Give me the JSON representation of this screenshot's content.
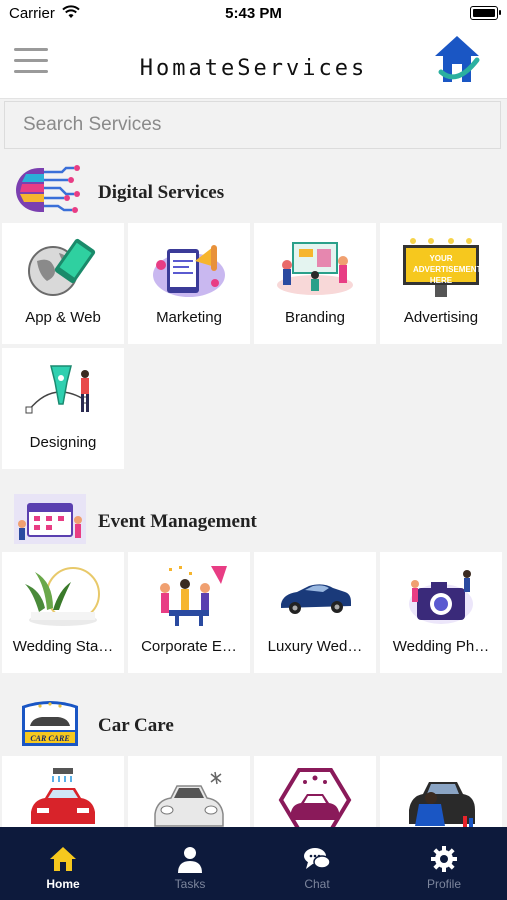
{
  "status_bar": {
    "carrier": "Carrier",
    "time": "5:43 PM"
  },
  "header": {
    "title": "HomateServices"
  },
  "search": {
    "placeholder": "Search Services"
  },
  "sections": [
    {
      "title": "Digital Services",
      "icon": "digital-services-icon",
      "items": [
        {
          "label": "App & Web",
          "icon": "app-web-icon"
        },
        {
          "label": "Marketing",
          "icon": "marketing-icon"
        },
        {
          "label": "Branding",
          "icon": "branding-icon"
        },
        {
          "label": "Advertising",
          "icon": "advertising-billboard-icon"
        },
        {
          "label": "Designing",
          "icon": "designing-pen-icon"
        }
      ]
    },
    {
      "title": "Event Management",
      "icon": "event-management-icon",
      "items": [
        {
          "label": "Wedding Sta…",
          "icon": "wedding-stage-icon"
        },
        {
          "label": "Corporate E…",
          "icon": "corporate-event-icon"
        },
        {
          "label": "Luxury Wed…",
          "icon": "luxury-car-icon"
        },
        {
          "label": "Wedding Ph…",
          "icon": "wedding-photography-icon"
        }
      ]
    },
    {
      "title": "Car Care",
      "icon": "car-care-icon",
      "items": [
        {
          "label": "",
          "icon": "car-wash-icon"
        },
        {
          "label": "",
          "icon": "car-polish-icon"
        },
        {
          "label": "",
          "icon": "car-detailing-icon"
        },
        {
          "label": "",
          "icon": "car-repair-icon"
        }
      ]
    }
  ],
  "art_text": {
    "billboard": "YOUR ADVERTISEMENT HERE",
    "car_care_logo": "CAR CARE"
  },
  "tabs": [
    {
      "label": "Home",
      "icon": "home-icon",
      "active": true
    },
    {
      "label": "Tasks",
      "icon": "person-icon",
      "active": false
    },
    {
      "label": "Chat",
      "icon": "chat-icon",
      "active": false
    },
    {
      "label": "Profile",
      "icon": "gear-icon",
      "active": false
    }
  ],
  "colors": {
    "tabbar_bg": "#0d1a3c",
    "brand_blue": "#1a56c4",
    "tile_bg": "#ffffff",
    "page_bg": "#f2f2f2"
  }
}
